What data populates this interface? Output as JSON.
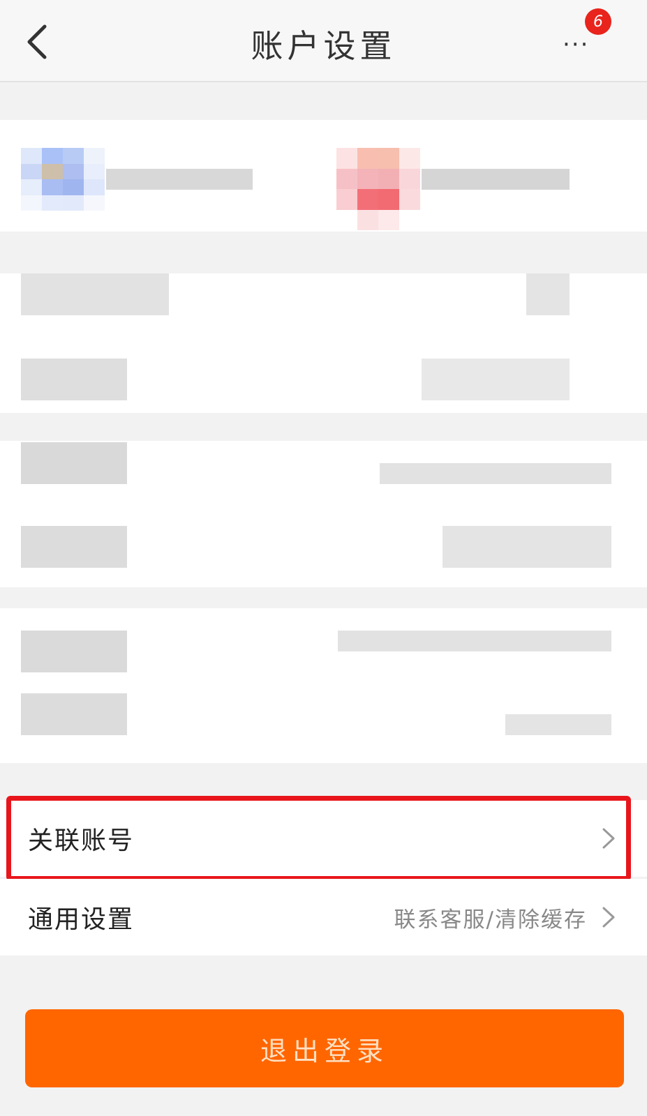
{
  "header": {
    "title": "账户设置",
    "back_icon": "chevron-left-icon",
    "more_icon": "more-dots-icon",
    "more_label": "···",
    "badge_count": "6"
  },
  "menu": {
    "linked_accounts": {
      "label": "关联账号"
    },
    "general_settings": {
      "label": "通用设置",
      "sub": "联系客服/清除缓存"
    }
  },
  "logout": {
    "label": "退出登录"
  },
  "colors": {
    "accent": "#ff6600",
    "highlight": "#e8161c",
    "badge": "#e8241c"
  }
}
